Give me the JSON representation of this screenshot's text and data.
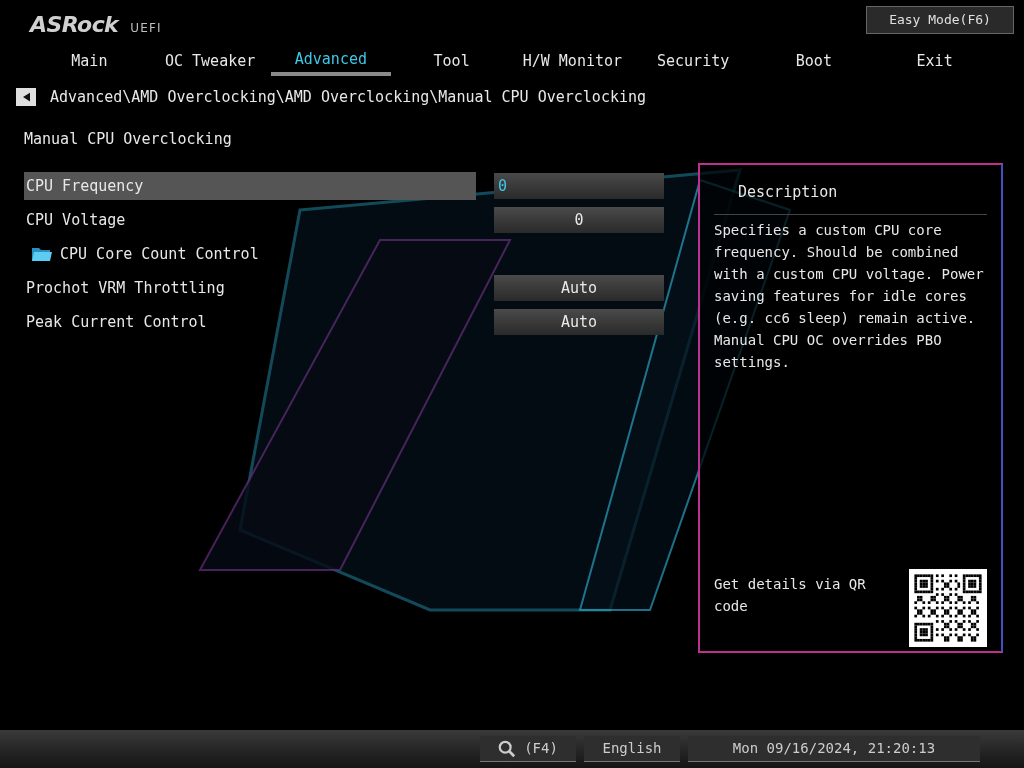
{
  "logo": {
    "brand": "ASRock",
    "suffix": "UEFI"
  },
  "easy_mode_button": "Easy Mode(F6)",
  "tabs": [
    {
      "label": "Main",
      "selected": false
    },
    {
      "label": "OC Tweaker",
      "selected": false
    },
    {
      "label": "Advanced",
      "selected": true
    },
    {
      "label": "Tool",
      "selected": false
    },
    {
      "label": "H/W Monitor",
      "selected": false
    },
    {
      "label": "Security",
      "selected": false
    },
    {
      "label": "Boot",
      "selected": false
    },
    {
      "label": "Exit",
      "selected": false
    }
  ],
  "breadcrumb": "Advanced\\AMD Overclocking\\AMD Overclocking\\Manual CPU Overclocking",
  "page_title": "Manual CPU Overclocking",
  "settings": [
    {
      "kind": "value",
      "label": "CPU Frequency",
      "value": "0",
      "selected": true
    },
    {
      "kind": "value",
      "label": "CPU Voltage",
      "value": "0",
      "selected": false
    },
    {
      "kind": "folder",
      "label": "CPU Core Count Control",
      "selected": false
    },
    {
      "kind": "value",
      "label": "Prochot VRM Throttling",
      "value": "Auto",
      "selected": false
    },
    {
      "kind": "value",
      "label": "Peak Current Control",
      "value": "Auto",
      "selected": false
    }
  ],
  "description": {
    "title": "Description",
    "text": "Specifies a custom CPU core frequency. Should be combined with a custom CPU voltage. Power saving features for idle cores (e.g. cc6 sleep) remain active. Manual CPU OC overrides PBO settings.",
    "qr_caption": "Get details via QR code"
  },
  "status_bar": {
    "search_key": "(F4)",
    "language": "English",
    "datetime": "Mon 09/16/2024, 21:20:13"
  }
}
